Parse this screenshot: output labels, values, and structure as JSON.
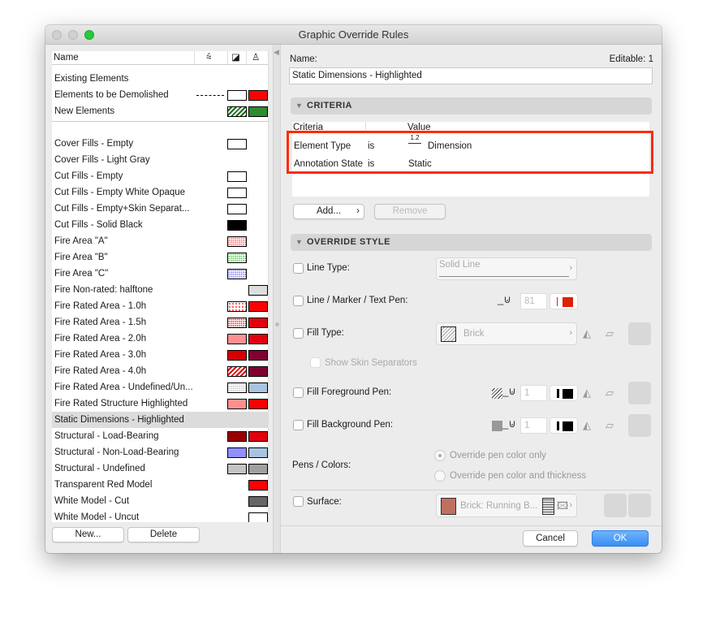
{
  "window": {
    "title": "Graphic Override Rules"
  },
  "list": {
    "header": {
      "name": "Name",
      "col_icons": [
        "line-type-icon",
        "fill-icon",
        "surface-brush-icon"
      ]
    },
    "group1": [
      {
        "label": "Existing Elements",
        "swatches": []
      },
      {
        "label": "Elements to be Demolished",
        "dash": true,
        "swatches": [
          {
            "bg": "#ffffff"
          },
          {
            "bg": "#ff0000"
          }
        ]
      },
      {
        "label": "New Elements",
        "swatches": [
          {
            "bg": "#ffffff",
            "pattern": "hatch",
            "color": "#1a6b1a"
          },
          {
            "bg": "#2e8b2e"
          }
        ]
      }
    ],
    "group2": [
      {
        "label": "Cover Fills - Empty",
        "s1": {
          "bg": "#ffffff"
        }
      },
      {
        "label": "Cover Fills - Light Gray"
      },
      {
        "label": "Cut Fills - Empty",
        "s1": {
          "bg": "#ffffff"
        }
      },
      {
        "label": "Cut Fills - Empty White Opaque",
        "s1": {
          "bg": "#ffffff"
        }
      },
      {
        "label": "Cut Fills - Empty+Skin Separat...",
        "s1": {
          "bg": "#ffffff"
        }
      },
      {
        "label": "Cut Fills - Solid Black",
        "s1": {
          "bg": "#000000"
        }
      },
      {
        "label": "Fire Area \"A\"",
        "s1": {
          "bg": "#ffffff",
          "pattern": "dots",
          "color": "#ff4040"
        }
      },
      {
        "label": "Fire Area \"B\"",
        "s1": {
          "bg": "#ffffff",
          "pattern": "dots",
          "color": "#30c030"
        }
      },
      {
        "label": "Fire Area \"C\"",
        "s1": {
          "bg": "#ffffff",
          "pattern": "dots",
          "color": "#6060ff"
        }
      },
      {
        "label": "Fire Non-rated: halftone",
        "s2": {
          "bg": "#dddddd"
        }
      },
      {
        "label": "Fire Rated Area - 1.0h",
        "s1": {
          "bg": "#ffffff",
          "pattern": "sparse",
          "color": "#ff0000"
        },
        "s2": {
          "bg": "#ff0000"
        }
      },
      {
        "label": "Fire Rated Area - 1.5h",
        "s1": {
          "bg": "#ffffff",
          "pattern": "dots",
          "color": "#ff0000"
        },
        "s2": {
          "bg": "#e00010"
        }
      },
      {
        "label": "Fire Rated Area - 2.0h",
        "s1": {
          "bg": "#ffffff",
          "pattern": "dense",
          "color": "#ff2020"
        },
        "s2": {
          "bg": "#e00010"
        }
      },
      {
        "label": "Fire Rated Area - 3.0h",
        "s1": {
          "bg": "#ff0000",
          "pattern": "dense",
          "color": "#aa0000"
        },
        "s2": {
          "bg": "#800030"
        }
      },
      {
        "label": "Fire Rated Area - 4.0h",
        "s1": {
          "bg": "#ffffff",
          "pattern": "hatch",
          "color": "#dd0000"
        },
        "s2": {
          "bg": "#800030"
        }
      },
      {
        "label": "Fire Rated Area - Undefined/Un...",
        "s1": {
          "bg": "#ffffff",
          "pattern": "dots",
          "color": "#bbbbbb"
        },
        "s2": {
          "bg": "#a8c4e0"
        }
      },
      {
        "label": "Fire Rated Structure Highlighted",
        "s1": {
          "bg": "#ffffff",
          "pattern": "dense",
          "color": "#ff2020"
        },
        "s2": {
          "bg": "#ff0000"
        }
      },
      {
        "label": "Static Dimensions - Highlighted",
        "selected": true
      },
      {
        "label": "Structural - Load-Bearing",
        "s1": {
          "bg": "#cc0000",
          "pattern": "dense",
          "color": "#660000"
        },
        "s2": {
          "bg": "#e00010"
        }
      },
      {
        "label": "Structural - Non-Load-Bearing",
        "s1": {
          "bg": "#2020ff",
          "pattern": "dense",
          "color": "#ffffff"
        },
        "s2": {
          "bg": "#a8c4e0"
        }
      },
      {
        "label": "Structural - Undefined",
        "s1": {
          "bg": "#ffffff",
          "pattern": "dense",
          "color": "#888888"
        },
        "s2": {
          "bg": "#a0a0a0"
        }
      },
      {
        "label": "Transparent Red Model",
        "s2": {
          "bg": "#ff0000"
        }
      },
      {
        "label": "White Model - Cut",
        "s2": {
          "bg": "#666666"
        }
      },
      {
        "label": "White Model - Uncut",
        "s2": {
          "bg": "#ffffff"
        }
      }
    ],
    "new_label": "New...",
    "delete_label": "Delete"
  },
  "detail": {
    "name_label": "Name:",
    "editable_label": "Editable: 1",
    "name_value": "Static Dimensions - Highlighted",
    "criteria_title": "CRITERIA",
    "criteria_cols": [
      "Criteria",
      "Value"
    ],
    "criteria_rows": [
      {
        "criterion": "Element Type",
        "op": "is",
        "value": "Dimension",
        "icon": "dimension-icon",
        "icon_text": "1.2"
      },
      {
        "criterion": "Annotation State",
        "op": "is",
        "value": "Static"
      }
    ],
    "highlight_color": "#ff2a0a",
    "add_label": "Add...",
    "remove_label": "Remove",
    "override_title": "OVERRIDE STYLE",
    "line_type": {
      "label": "Line Type:",
      "value": "Solid Line"
    },
    "line_pen": {
      "label": "Line / Marker / Text Pen:",
      "value": "81",
      "color": "#dd2200"
    },
    "fill_type": {
      "label": "Fill Type:",
      "value": "Brick"
    },
    "skin_sep": "Show Skin Separators",
    "fg_pen": {
      "label": "Fill Foreground Pen:",
      "value": "1"
    },
    "bg_pen": {
      "label": "Fill Background Pen:",
      "value": "1"
    },
    "pens_colors": {
      "label": "Pens / Colors:",
      "options": [
        "Override pen color only",
        "Override pen color and thickness"
      ],
      "selected": 0
    },
    "surface": {
      "label": "Surface:",
      "value": "Brick: Running B...",
      "color": "#c07060"
    },
    "cancel_label": "Cancel",
    "ok_label": "OK",
    "accent": "#3a8ef6"
  }
}
